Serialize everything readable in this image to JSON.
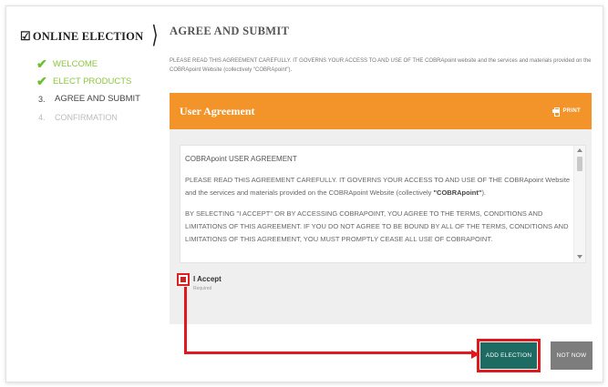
{
  "sidebar": {
    "app_title": "ONLINE ELECTION",
    "ballot_icon": "☑",
    "chevron": "⟩",
    "steps": [
      {
        "marker": "✔",
        "label": "WELCOME",
        "state": "done"
      },
      {
        "marker": "✔",
        "label": "ELECT PRODUCTS",
        "state": "done"
      },
      {
        "marker": "3.",
        "label": "AGREE AND SUBMIT",
        "state": "current"
      },
      {
        "marker": "4.",
        "label": "CONFIRMATION",
        "state": "todo"
      }
    ]
  },
  "main": {
    "page_title": "AGREE AND SUBMIT",
    "intro": "PLEASE READ THIS AGREEMENT CAREFULLY. IT GOVERNS YOUR ACCESS TO AND USE OF THE COBRApoint website and the services and materials provided on the COBRApoint Website (collectively \"COBRApoint\").",
    "panel": {
      "title": "User Agreement",
      "print_label": "PRINT",
      "agreement": {
        "heading": "COBRApoint USER AGREEMENT",
        "p1": "PLEASE READ THIS AGREEMENT CAREFULLY. IT GOVERNS YOUR ACCESS TO AND USE OF THE COBRApoint Website and the services and materials provided on the COBRApoint Website (collectively ",
        "p1_bold": "\"COBRApoint\"",
        "p1_end": ").",
        "p2": "BY SELECTING \"I ACCEPT\" OR BY ACCESSING COBRAPOINT, YOU AGREE TO THE TERMS, CONDITIONS AND LIMITATIONS OF THIS AGREEMENT. IF YOU DO NOT AGREE TO BE BOUND BY ALL OF THE TERMS, CONDITIONS AND LIMITATIONS OF THIS AGREEMENT, YOU MUST PROMPTLY CEASE ALL USE OF COBRAPOINT."
      },
      "accept_label": "I Accept",
      "required_label": "Required"
    },
    "buttons": {
      "add_election": "ADD ELECTION",
      "not_now": "NOT NOW"
    }
  },
  "colors": {
    "accent_orange": "#f29429",
    "done_green": "#8cc63f",
    "add_button": "#1e6b63",
    "not_now_button": "#7d7d7d",
    "annotation_red": "#e0191e"
  }
}
